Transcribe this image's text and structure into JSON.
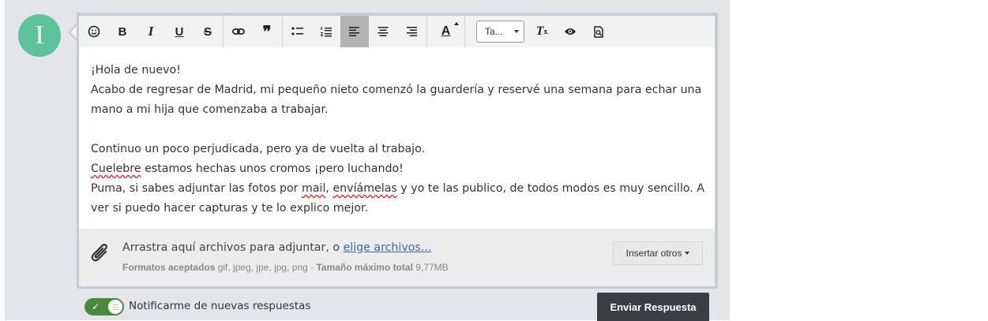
{
  "avatar": {
    "initial": "I",
    "color": "#5cc39c"
  },
  "toolbar": {
    "groups": [
      [
        "emoji-icon",
        "bold-icon",
        "italic-icon",
        "underline-icon",
        "strikethrough-icon"
      ],
      [
        "link-icon",
        "quote-icon"
      ],
      [
        "bullet-list-icon",
        "numbered-list-icon",
        "align-left-icon",
        "align-center-icon",
        "align-right-icon"
      ],
      [
        "text-color-icon"
      ],
      [
        "font-size-select",
        "clear-format-icon",
        "preview-icon",
        "fullscreen-preview-icon"
      ]
    ],
    "active": "align-left-icon",
    "bold_label": "B",
    "italic_label": "I",
    "underline_label": "U",
    "strike_label": "S",
    "quote_label": "❞",
    "text_color_label": "A",
    "clear_format_label": "T",
    "font_size_select": "Ta..."
  },
  "content": {
    "line1": "¡Hola de nuevo!",
    "line2": "Acabo de regresar de Madrid, mi pequeño nieto comenzó la guardería y reservé una semana para echar una",
    "line3": "mano a mi hija que comenzaba a trabajar.",
    "line5": "Continuo un poco perjudicada, pero ya de vuelta al trabajo.",
    "line6_word": "Cuelebre",
    "line6_rest": " estamos hechas unos cromos ¡pero luchando!",
    "line7_a": "Puma, si sabes adjuntar las fotos por ",
    "line7_mail": "mail",
    "line7_b": ", ",
    "line7_word": "envíámelas",
    "line7_c": " y yo te las publico, de todos modos es muy sencillo. A",
    "line8": "ver si puedo hacer capturas y te lo explico mejor."
  },
  "attach": {
    "text": "Arrastra aquí archivos para adjuntar, o ",
    "link": "elige archivos...",
    "formats_label": "Formatos aceptados",
    "formats": " gif, jpeg, jpe, jpg, png · ",
    "max_label": "Tamaño máximo total",
    "max": " 9,77MB",
    "insert_button": "Insertar otros"
  },
  "footer": {
    "notify_label": "Notificarme de nuevas respuestas",
    "notify_on": true,
    "send_button": "Enviar Respuesta"
  }
}
